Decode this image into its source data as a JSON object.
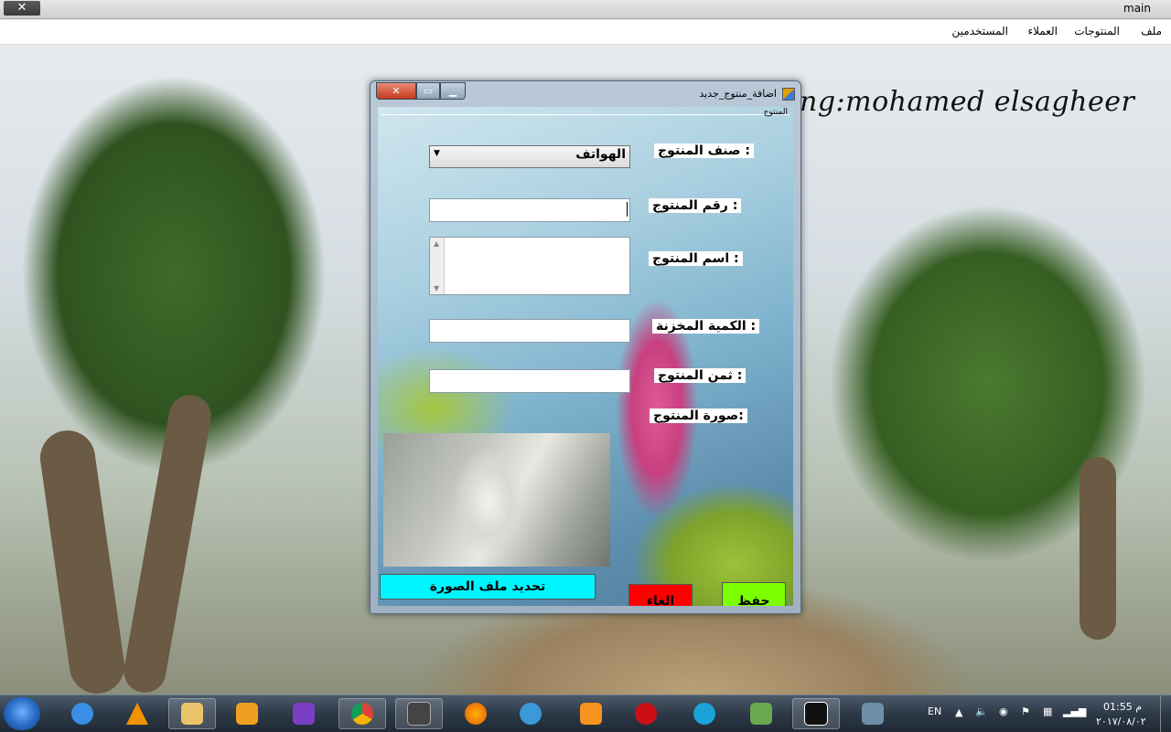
{
  "window_title": "main",
  "menu": [
    "ملف",
    "المنتوجات",
    "العملاء",
    "المستخدمين"
  ],
  "background_text": "ng:mohamed elsagheer",
  "dialog": {
    "title": "اضافة_منتوج_جديد",
    "group_label": "المنتوج",
    "labels": {
      "category": "صنف المنتوج :",
      "number": "رقم المنتوج :",
      "name": "اسم المنتوج :",
      "stock": "الكمية المخزنة :",
      "price": "ثمن المنتوج :",
      "image": "صورة المنتوج:"
    },
    "category_value": "الهواتف",
    "number_value": "",
    "name_value": "",
    "stock_value": "",
    "price_value": "",
    "buttons": {
      "pick_image": "تحديد ملف الصورة",
      "cancel": "الغاء",
      "save": "حفظ"
    },
    "colors": {
      "pick_image": "#00f5ff",
      "cancel": "#ff0000",
      "save": "#7cff00"
    }
  },
  "taskbar": {
    "apps": [
      "ie-icon",
      "vlc-icon",
      "explorer-icon",
      "media-player-icon",
      "visual-studio-icon",
      "chrome-icon",
      "media-player-classic-icon",
      "firefox-icon",
      "browser-icon",
      "pdf-icon",
      "opera-icon",
      "video-icon",
      "tool-icon",
      "briefcase-icon",
      "app-icon"
    ],
    "language": "EN",
    "time": "01:55 م",
    "date": "٢٠١٧/٠٨/٠٢"
  }
}
